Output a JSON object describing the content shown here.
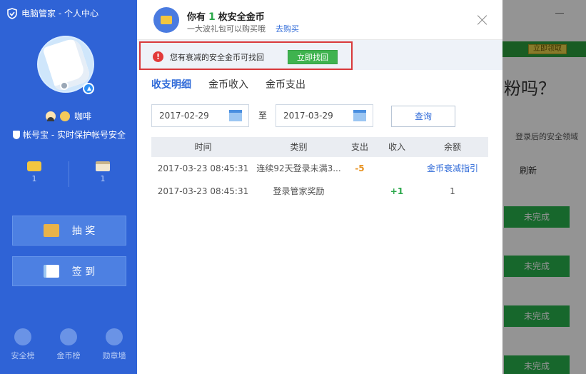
{
  "colors": {
    "sidebar": "#2f63d6",
    "accent_blue": "#2f6ad8",
    "accent_green": "#3fb34f",
    "warning_red": "#d9393b",
    "expense_orange": "#e89322",
    "income_green": "#2aa84a"
  },
  "sidebar": {
    "title": "电脑管家 - 个人中心",
    "title_icon": "shield-icon",
    "username": "咖啡",
    "account_protect": "帐号宝 - 实时保护帐号安全",
    "stats": [
      {
        "icon": "coin-icon",
        "value": "1"
      },
      {
        "icon": "gift-icon",
        "value": "1"
      }
    ],
    "buttons": [
      {
        "icon": "lottery-icon",
        "label": "抽 奖"
      },
      {
        "icon": "checkin-icon",
        "label": "签 到"
      }
    ],
    "nav": [
      {
        "icon": "shield-rank-icon",
        "label": "安全榜"
      },
      {
        "icon": "crown-icon",
        "label": "金币榜"
      },
      {
        "icon": "medal-icon",
        "label": "勋章墙"
      }
    ]
  },
  "dialog": {
    "title_prefix": "你有",
    "coin_count": "1",
    "title_suffix": "枚安全金币",
    "subtitle": "一大波礼包可以购买哦",
    "buy_link": "去购买",
    "notice_text": "您有衰减的安全金币可找回",
    "recover_button": "立即找回",
    "tabs": [
      "收支明细",
      "金币收入",
      "金币支出"
    ],
    "date_from": "2017-02-29",
    "date_to_label": "至",
    "date_to": "2017-03-29",
    "query_button": "查询",
    "table": {
      "headers": [
        "时间",
        "类别",
        "支出",
        "收入",
        "余额"
      ],
      "rows": [
        {
          "time": "2017-03-23 08:45:31",
          "category": "连续92天登录未满3...",
          "out": "-5",
          "in": "",
          "balance": "金币衰减指引"
        },
        {
          "time": "2017-03-23 08:45:31",
          "category": "登录管家奖励",
          "out": "",
          "in": "+1",
          "balance": "1"
        }
      ]
    }
  },
  "background": {
    "top_button": "立即领取",
    "question": "粉吗？",
    "line1": "登录后的安全领域",
    "line2": "刷新",
    "buttons": [
      "未完成",
      "未完成",
      "未完成",
      "未完成"
    ]
  }
}
